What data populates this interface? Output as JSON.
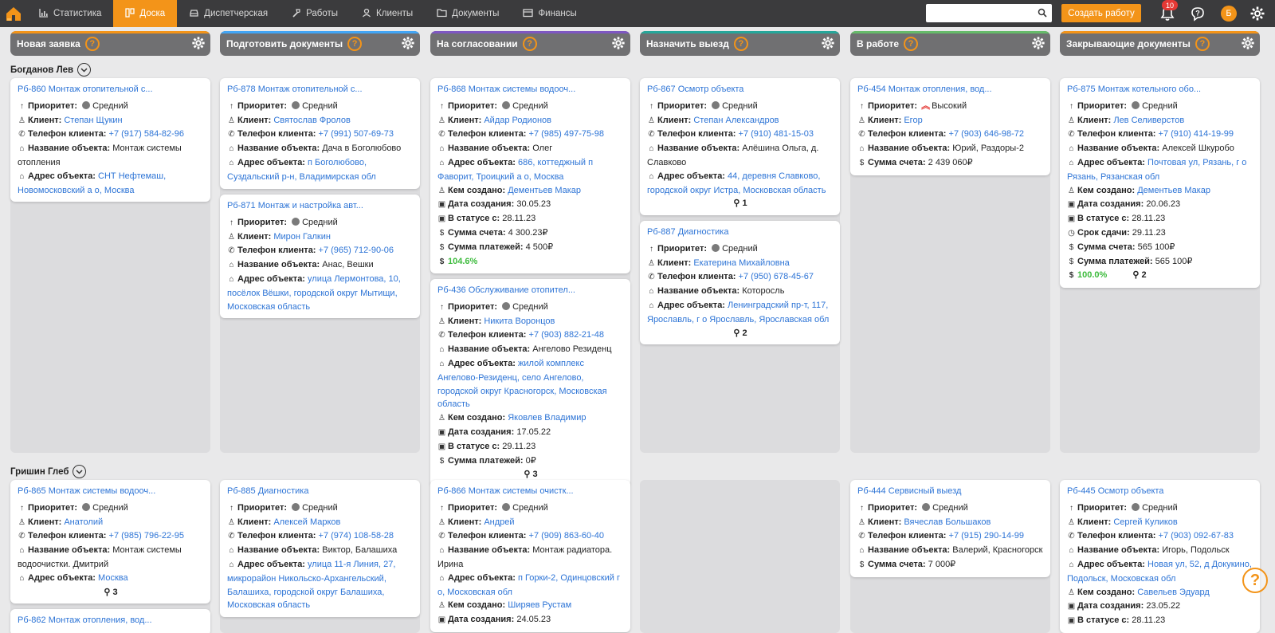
{
  "nav": {
    "items": [
      {
        "label": "Статистика",
        "icon": "chart-icon"
      },
      {
        "label": "Доска",
        "icon": "board-icon",
        "active": true
      },
      {
        "label": "Диспетчерская",
        "icon": "car-icon"
      },
      {
        "label": "Работы",
        "icon": "hammer-icon"
      },
      {
        "label": "Клиенты",
        "icon": "user-icon"
      },
      {
        "label": "Документы",
        "icon": "folder-icon"
      },
      {
        "label": "Финансы",
        "icon": "wallet-icon"
      }
    ],
    "search_placeholder": "",
    "create_label": "Создать работу",
    "notifications_count": "10",
    "avatar_letter": "Б",
    "accent": "#f39419"
  },
  "columns": [
    {
      "title": "Новая заявка",
      "stripe": "#f39419"
    },
    {
      "title": "Подготовить документы",
      "stripe": "#42a5f5"
    },
    {
      "title": "На согласовании",
      "stripe": "#7e57c2"
    },
    {
      "title": "Назначить выезд",
      "stripe": "#26a69a"
    },
    {
      "title": "В работе",
      "stripe": "#66bb6a"
    },
    {
      "title": "Закрывающие документы",
      "stripe": "#f39419"
    }
  ],
  "groups": [
    {
      "name": "Богданов Лев",
      "cols": [
        [
          {
            "title": "Рб-860 Монтаж отопительной с...",
            "rows": [
              {
                "k": "Приоритет:",
                "prio": "Средний"
              },
              {
                "k": "Клиент:",
                "v": "Степан Щукин",
                "link": true
              },
              {
                "k": "Телефон клиента:",
                "v": "+7 (917) 584-82-96",
                "link": true
              },
              {
                "k": "Название объекта:",
                "v": "Монтаж системы отопления"
              },
              {
                "k": "Адрес объекта:",
                "v": "СНТ Нефтемаш, Новомосковский а о, Москва",
                "link": true
              }
            ]
          }
        ],
        [
          {
            "title": "Рб-878 Монтаж отопительной с...",
            "rows": [
              {
                "k": "Приоритет:",
                "prio": "Средний"
              },
              {
                "k": "Клиент:",
                "v": "Святослав Фролов",
                "link": true
              },
              {
                "k": "Телефон клиента:",
                "v": "+7 (991) 507-69-73",
                "link": true
              },
              {
                "k": "Название объекта:",
                "v": "Дача в Боголюбово"
              },
              {
                "k": "Адрес объекта:",
                "v": "п Боголюбово, Суздальский р-н, Владимирская обл",
                "link": true
              }
            ]
          },
          {
            "title": "Рб-871 Монтаж и настройка авт...",
            "rows": [
              {
                "k": "Приоритет:",
                "prio": "Средний"
              },
              {
                "k": "Клиент:",
                "v": "Мирон Галкин",
                "link": true
              },
              {
                "k": "Телефон клиента:",
                "v": "+7 (965) 712-90-06",
                "link": true
              },
              {
                "k": "Название объекта:",
                "v": "Анас, Вешки"
              },
              {
                "k": "Адрес объекта:",
                "v": "улица Лермонтова, 10, посёлок Вёшки, городской округ Мытищи, Московская область",
                "link": true
              }
            ]
          }
        ],
        [
          {
            "title": "Рб-868 Монтаж системы водооч...",
            "rows": [
              {
                "k": "Приоритет:",
                "prio": "Средний"
              },
              {
                "k": "Клиент:",
                "v": "Айдар Родионов",
                "link": true
              },
              {
                "k": "Телефон клиента:",
                "v": "+7 (985) 497-75-98",
                "link": true
              },
              {
                "k": "Название объекта:",
                "v": "Олег"
              },
              {
                "k": "Адрес объекта:",
                "v": "686, коттеджный п Фаворит, Троицкий а о, Москва",
                "link": true
              },
              {
                "k": "Кем создано:",
                "v": "Дементьев Макар",
                "link": true
              },
              {
                "k": "Дата создания:",
                "v": "30.05.23"
              },
              {
                "k": "В статусе с:",
                "v": "28.11.23"
              },
              {
                "k": "Сумма счета:",
                "v": "4 300.23₽"
              },
              {
                "k": "Сумма платежей:",
                "v": "4 500₽"
              }
            ],
            "percent": "104.6%"
          },
          {
            "title": "Рб-436 Обслуживание отопител...",
            "rows": [
              {
                "k": "Приоритет:",
                "prio": "Средний"
              },
              {
                "k": "Клиент:",
                "v": "Никита Воронцов",
                "link": true
              },
              {
                "k": "Телефон клиента:",
                "v": "+7 (903) 882-21-48",
                "link": true
              },
              {
                "k": "Название объекта:",
                "v": "Ангелово Резиденц"
              },
              {
                "k": "Адрес объекта:",
                "v": "жилой комплекс Ангелово-Резиденц, село Ангелово, городской округ Красногорск, Московская область",
                "link": true
              },
              {
                "k": "Кем создано:",
                "v": "Яковлев Владимир",
                "link": true
              },
              {
                "k": "Дата создания:",
                "v": "17.05.22"
              },
              {
                "k": "В статусе с:",
                "v": "29.11.23"
              },
              {
                "k": "Сумма платежей:",
                "v": "0₽"
              }
            ],
            "attach": "3"
          }
        ],
        [
          {
            "title": "Рб-867 Осмотр объекта",
            "rows": [
              {
                "k": "Приоритет:",
                "prio": "Средний"
              },
              {
                "k": "Клиент:",
                "v": "Степан Александров",
                "link": true
              },
              {
                "k": "Телефон клиента:",
                "v": "+7 (910) 481-15-03",
                "link": true
              },
              {
                "k": "Название объекта:",
                "v": "Алёшина Ольга, д. Славково"
              },
              {
                "k": "Адрес объекта:",
                "v": "44, деревня Славково, городской округ Истра, Московская область",
                "link": true
              }
            ],
            "attach": "1"
          },
          {
            "title": "Рб-887 Диагностика",
            "rows": [
              {
                "k": "Приоритет:",
                "prio": "Средний"
              },
              {
                "k": "Клиент:",
                "v": "Екатерина Михайловна",
                "link": true
              },
              {
                "k": "Телефон клиента:",
                "v": "+7 (950) 678-45-67",
                "link": true
              },
              {
                "k": "Название объекта:",
                "v": "Которосль"
              },
              {
                "k": "Адрес объекта:",
                "v": "Ленинградский пр-т, 117, Ярославль, г о Ярославль, Ярославская обл",
                "link": true
              }
            ],
            "attach": "2"
          }
        ],
        [
          {
            "title": "Рб-454 Монтаж отопления, вод...",
            "rows": [
              {
                "k": "Приоритет:",
                "prio": "Высокий",
                "high": true
              },
              {
                "k": "Клиент:",
                "v": "Егор",
                "link": true
              },
              {
                "k": "Телефон клиента:",
                "v": "+7 (903) 646-98-72",
                "link": true
              },
              {
                "k": "Название объекта:",
                "v": "Юрий, Раздоры-2"
              },
              {
                "k": "Сумма счета:",
                "v": "2 439 060₽"
              }
            ]
          }
        ],
        [
          {
            "title": "Рб-875 Монтаж котельного обо...",
            "rows": [
              {
                "k": "Приоритет:",
                "prio": "Средний"
              },
              {
                "k": "Клиент:",
                "v": "Лев Селиверстов",
                "link": true
              },
              {
                "k": "Телефон клиента:",
                "v": "+7 (910) 414-19-99",
                "link": true
              },
              {
                "k": "Название объекта:",
                "v": "Алексей Шкуробо"
              },
              {
                "k": "Адрес объекта:",
                "v": "Почтовая ул, Рязань, г о Рязань, Рязанская обл",
                "link": true
              },
              {
                "k": "Кем создано:",
                "v": "Дементьев Макар",
                "link": true
              },
              {
                "k": "Дата создания:",
                "v": "20.06.23"
              },
              {
                "k": "В статусе с:",
                "v": "28.11.23"
              },
              {
                "k": "Срок сдачи:",
                "v": "29.11.23"
              },
              {
                "k": "Сумма счета:",
                "v": "565 100₽"
              },
              {
                "k": "Сумма платежей:",
                "v": "565 100₽"
              }
            ],
            "percent": "100.0%",
            "attach_inline": "2"
          }
        ]
      ]
    },
    {
      "name": "Гришин Глеб",
      "cols": [
        [
          {
            "title": "Рб-865 Монтаж системы водооч...",
            "rows": [
              {
                "k": "Приоритет:",
                "prio": "Средний"
              },
              {
                "k": "Клиент:",
                "v": "Анатолий",
                "link": true
              },
              {
                "k": "Телефон клиента:",
                "v": "+7 (985) 796-22-95",
                "link": true
              },
              {
                "k": "Название объекта:",
                "v": "Монтаж системы водоочистки. Дмитрий"
              },
              {
                "k": "Адрес объекта:",
                "v": "Москва",
                "link": true
              }
            ],
            "attach": "3"
          },
          {
            "title": "Рб-862 Монтаж отопления, вод...",
            "rows": []
          }
        ],
        [
          {
            "title": "Рб-885 Диагностика",
            "rows": [
              {
                "k": "Приоритет:",
                "prio": "Средний"
              },
              {
                "k": "Клиент:",
                "v": "Алексей Марков",
                "link": true
              },
              {
                "k": "Телефон клиента:",
                "v": "+7 (974) 108-58-28",
                "link": true
              },
              {
                "k": "Название объекта:",
                "v": "Виктор, Балашиха"
              },
              {
                "k": "Адрес объекта:",
                "v": "улица 11-я Линия, 27, микрорайон Никольско-Архангельский, Балашиха, городской округ Балашиха, Московская область",
                "link": true
              }
            ]
          }
        ],
        [
          {
            "title": "Рб-866 Монтаж системы очистк...",
            "rows": [
              {
                "k": "Приоритет:",
                "prio": "Средний"
              },
              {
                "k": "Клиент:",
                "v": "Андрей",
                "link": true
              },
              {
                "k": "Телефон клиента:",
                "v": "+7 (909) 863-60-40",
                "link": true
              },
              {
                "k": "Название объекта:",
                "v": "Монтаж радиатора. Ирина"
              },
              {
                "k": "Адрес объекта:",
                "v": "п Горки-2, Одинцовский г о, Московская обл",
                "link": true
              },
              {
                "k": "Кем создано:",
                "v": "Ширяев Рустам",
                "link": true
              },
              {
                "k": "Дата создания:",
                "v": "24.05.23"
              }
            ]
          }
        ],
        [],
        [
          {
            "title": "Рб-444 Сервисный выезд",
            "rows": [
              {
                "k": "Приоритет:",
                "prio": "Средний"
              },
              {
                "k": "Клиент:",
                "v": "Вячеслав Большаков",
                "link": true
              },
              {
                "k": "Телефон клиента:",
                "v": "+7 (915) 290-14-99",
                "link": true
              },
              {
                "k": "Название объекта:",
                "v": "Валерий, Красногорск"
              },
              {
                "k": "Сумма счета:",
                "v": "7 000₽"
              }
            ]
          }
        ],
        [
          {
            "title": "Рб-445 Осмотр объекта",
            "rows": [
              {
                "k": "Приоритет:",
                "prio": "Средний"
              },
              {
                "k": "Клиент:",
                "v": "Сергей Куликов",
                "link": true
              },
              {
                "k": "Телефон клиента:",
                "v": "+7 (903) 092-67-83",
                "link": true
              },
              {
                "k": "Название объекта:",
                "v": "Игорь, Подольск"
              },
              {
                "k": "Адрес объекта:",
                "v": "Новая ул, 52, д Докукино, Подольск, Московская обл",
                "link": true
              },
              {
                "k": "Кем создано:",
                "v": "Савельев Эдуард",
                "link": true
              },
              {
                "k": "Дата создания:",
                "v": "23.05.22"
              },
              {
                "k": "В статусе с:",
                "v": "28.11.23"
              }
            ]
          }
        ]
      ]
    }
  ],
  "help_label": "?"
}
